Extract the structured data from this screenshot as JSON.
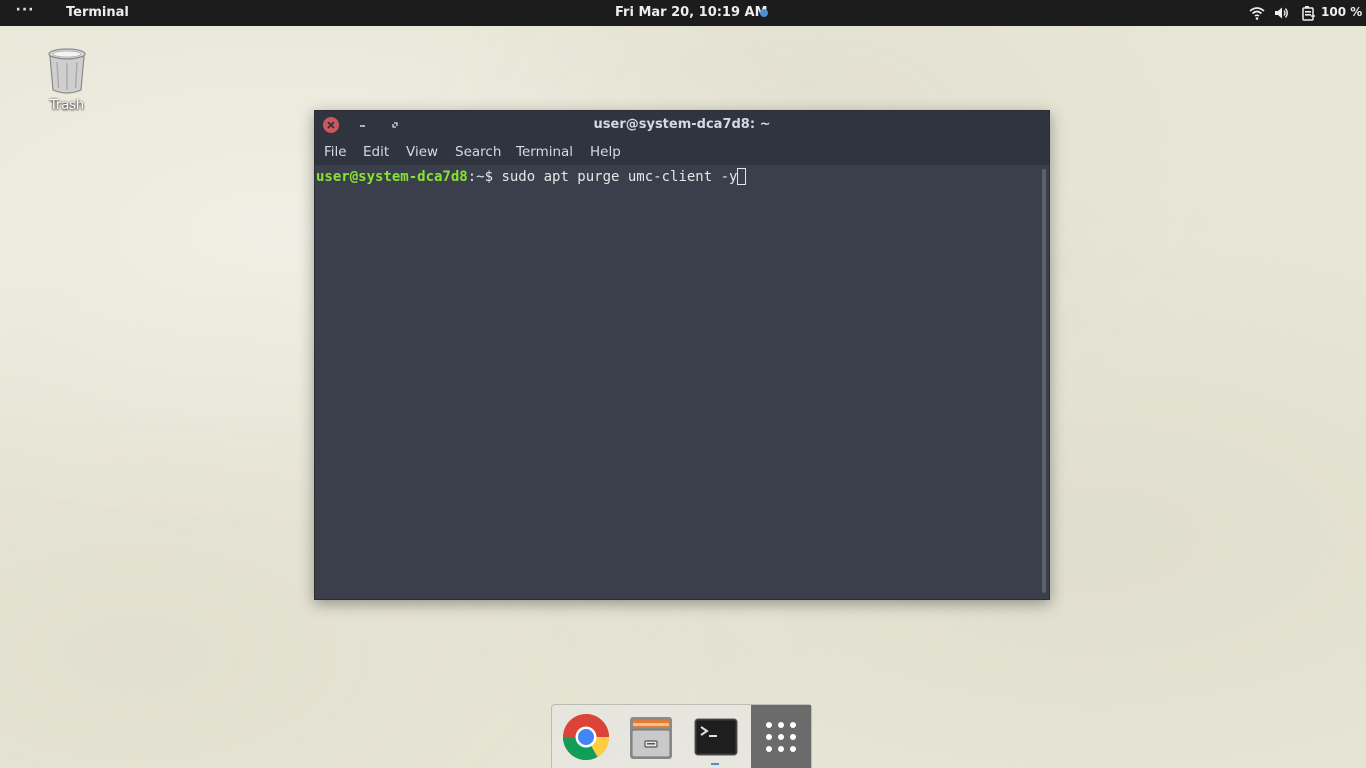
{
  "top_panel": {
    "activities_icon": "dots-icon",
    "app_name": "Terminal",
    "clock": "Fri Mar 20, 10:19 AM",
    "notification_color": "#4a90d9",
    "tray": {
      "wifi_icon": "wifi-icon",
      "volume_icon": "volume-icon",
      "battery_icon": "battery-icon",
      "battery_percent": "100 %"
    }
  },
  "desktop": {
    "icons": [
      {
        "label": "Trash",
        "icon": "trash-icon"
      }
    ]
  },
  "terminal": {
    "title": "user@system-dca7d8: ~",
    "menu": [
      "File",
      "Edit",
      "View",
      "Search",
      "Terminal",
      "Help"
    ],
    "prompt_user_host": "user@system-dca7d8",
    "prompt_path": ":~$ ",
    "command": "sudo apt purge umc-client -y",
    "colors": {
      "background": "#3a3f4b",
      "prompt": "#8ae234",
      "close_button": "#cc575d"
    }
  },
  "dock": {
    "items": [
      {
        "name": "Google Chrome",
        "icon": "chrome-icon"
      },
      {
        "name": "Files",
        "icon": "file-manager-icon"
      },
      {
        "name": "Terminal",
        "icon": "terminal-icon",
        "running": true
      },
      {
        "name": "Show Applications",
        "icon": "app-grid-icon"
      }
    ]
  }
}
